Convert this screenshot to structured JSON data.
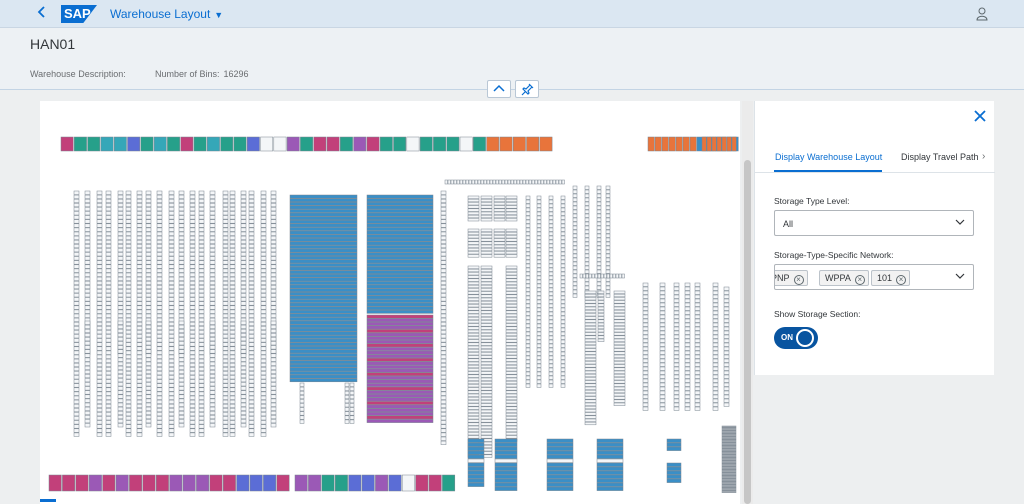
{
  "shell": {
    "app_title": "Warehouse Layout",
    "logo_text": "SAP"
  },
  "header": {
    "object_title": "HAN01",
    "description_label": "Warehouse Description:",
    "description_value": "",
    "bins_label": "Number of Bins:",
    "bins_value": "16296"
  },
  "panel": {
    "tabs": [
      {
        "label": "Display Warehouse Layout",
        "selected": true
      },
      {
        "label": "Display Travel Path",
        "selected": false
      }
    ],
    "storage_type_level": {
      "label": "Storage Type Level:",
      "value": "All"
    },
    "network": {
      "label": "Storage-Type-Specific Network:",
      "tokens": [
        "PNP",
        "WPPA",
        "101"
      ]
    },
    "storage_section": {
      "label": "Show Storage Section:",
      "state": "ON"
    }
  },
  "colors": {
    "accent": "#0a6ed1",
    "bin_blue": "#3a8fc7",
    "bin_purple": "#9b59b6",
    "bin_magenta": "#c2407a",
    "bin_teal": "#26a08a",
    "bin_orange": "#e8743b",
    "bin_cyan": "#35a7b8",
    "bin_indigo": "#5b6dd6",
    "bin_empty": "#f4f6f8",
    "bin_border": "#7a8590"
  }
}
